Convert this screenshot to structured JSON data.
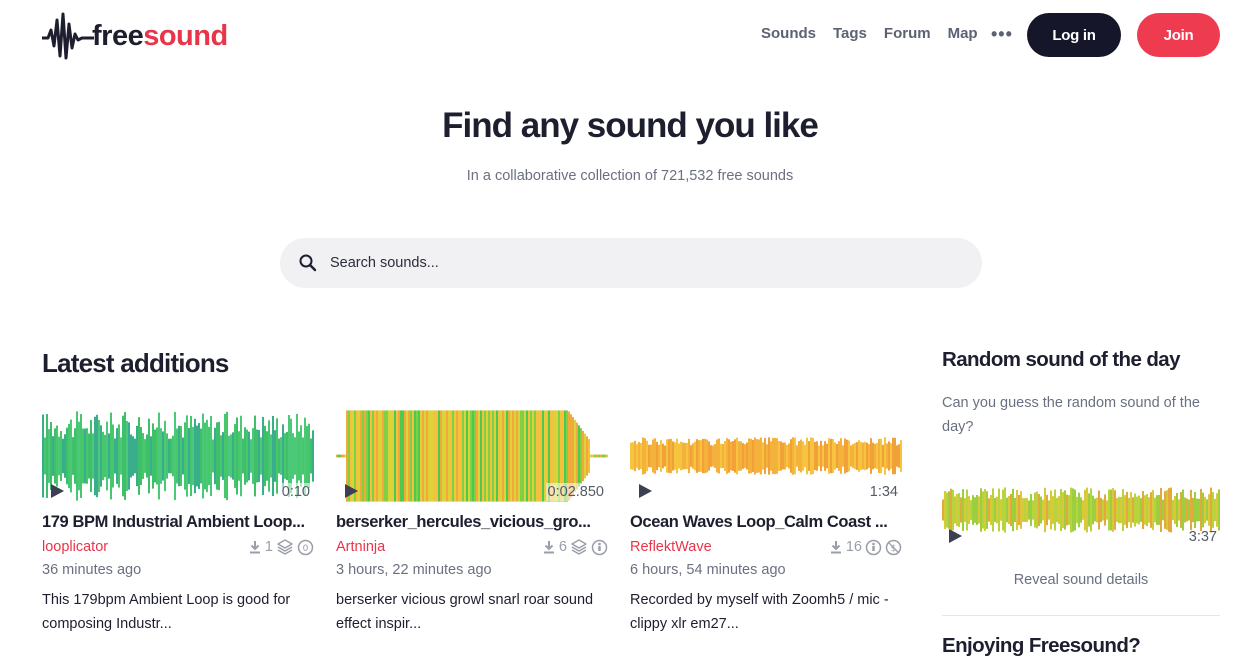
{
  "header": {
    "logo_free": "free",
    "logo_sound": "sound",
    "nav": [
      "Sounds",
      "Tags",
      "Forum",
      "Map"
    ],
    "more": "•••",
    "login_label": "Log in",
    "join_label": "Join"
  },
  "hero": {
    "title": "Find any sound you like",
    "subtitle": "In a collaborative collection of 721,532 free sounds"
  },
  "search": {
    "placeholder": "Search sounds..."
  },
  "latest": {
    "title": "Latest additions",
    "cards": [
      {
        "title": "179 BPM Industrial Ambient Loop...",
        "author": "looplicator",
        "downloads": "1",
        "time": "36 minutes ago",
        "desc": "This 179bpm Ambient Loop is good for composing Industr...",
        "duration": "0:10",
        "wave_colors": [
          "#3fbf6a",
          "#46c76b",
          "#4cc978",
          "#3aae8c"
        ]
      },
      {
        "title": "berserker_hercules_vicious_gro...",
        "author": "Artninja",
        "downloads": "6",
        "time": "3 hours, 22 minutes ago",
        "desc": "berserker vicious growl snarl roar sound effect inspir...",
        "duration": "0:02.850",
        "wave_colors": [
          "#f2a93b",
          "#f5c03c",
          "#dcd23a",
          "#7fd044",
          "#4cc94e"
        ]
      },
      {
        "title": "Ocean Waves Loop_Calm Coast ...",
        "author": "ReflektWave",
        "downloads": "16",
        "time": "6 hours, 54 minutes ago",
        "desc": "Recorded by myself with Zoomh5 / mic - clippy xlr em27...",
        "duration": "1:34",
        "wave_colors": [
          "#f4b23d",
          "#f2a038",
          "#f6c43e"
        ]
      }
    ]
  },
  "sidebar": {
    "random_title": "Random sound of the day",
    "random_text": "Can you guess the random sound of the day?",
    "random_duration": "3:37",
    "reveal": "Reveal sound details",
    "enjoy_title": "Enjoying Freesound?"
  }
}
